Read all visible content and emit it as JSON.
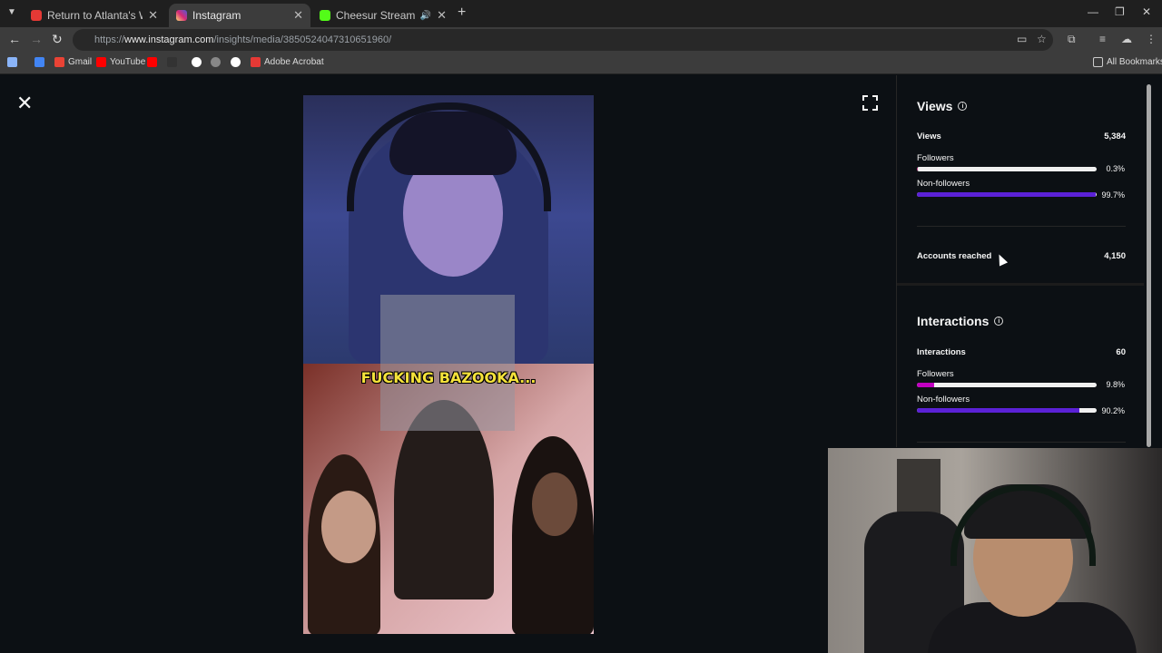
{
  "browser": {
    "tabs": [
      {
        "title": "Return to Atlanta's Wildest Jail",
        "favicon_color": "#e53935",
        "active": false
      },
      {
        "title": "Instagram",
        "favicon_color": "#d6249f",
        "active": true
      },
      {
        "title": "Cheesur Stream - Watch Li",
        "favicon_color": "#53fc18",
        "active": false
      }
    ],
    "new_tab_icon": "+",
    "url_prefix": "https://",
    "url_host": "www.instagram.com",
    "url_path": "/insights/media/3850524047310651960/"
  },
  "bookmarks": [
    {
      "label": "",
      "icon": "apps-grid-icon",
      "color": "#8ab4f8"
    },
    {
      "label": "",
      "icon": "docs-icon",
      "color": "#4285f4"
    },
    {
      "label": "Gmail",
      "icon": "gmail-icon",
      "color": "#ea4335"
    },
    {
      "label": "YouTube",
      "icon": "youtube-icon",
      "color": "#ff0000"
    },
    {
      "label": "",
      "icon": "youtube-icon",
      "color": "#ff0000"
    },
    {
      "label": "",
      "icon": "globe-icon",
      "color": "#333333"
    },
    {
      "label": "",
      "icon": "google-icon",
      "color": "#ffffff"
    },
    {
      "label": "",
      "icon": "globe-icon",
      "color": "#888888"
    },
    {
      "label": "",
      "icon": "google-icon",
      "color": "#ffffff"
    },
    {
      "label": "Adobe Acrobat",
      "icon": "acrobat-icon",
      "color": "#e53935"
    }
  ],
  "all_bookmarks": "All Bookmarks",
  "video": {
    "caption": "FUCKING BAZOOKA..."
  },
  "insights": {
    "views": {
      "title": "Views",
      "total_label": "Views",
      "total_value": "5,384",
      "breakdown": [
        {
          "label": "Followers",
          "percent_text": "0.3%",
          "percent": 0.3,
          "color": "#c13584"
        },
        {
          "label": "Non-followers",
          "percent_text": "99.7%",
          "percent": 99.7,
          "color": "#5b21d6"
        }
      ],
      "accounts_reached_label": "Accounts reached",
      "accounts_reached_value": "4,150"
    },
    "interactions": {
      "title": "Interactions",
      "total_label": "Interactions",
      "total_value": "60",
      "breakdown": [
        {
          "label": "Followers",
          "percent_text": "9.8%",
          "percent": 9.8,
          "color": "#c100c1"
        },
        {
          "label": "Non-followers",
          "percent_text": "90.2%",
          "percent": 90.2,
          "color": "#5b21d6"
        }
      ]
    }
  }
}
